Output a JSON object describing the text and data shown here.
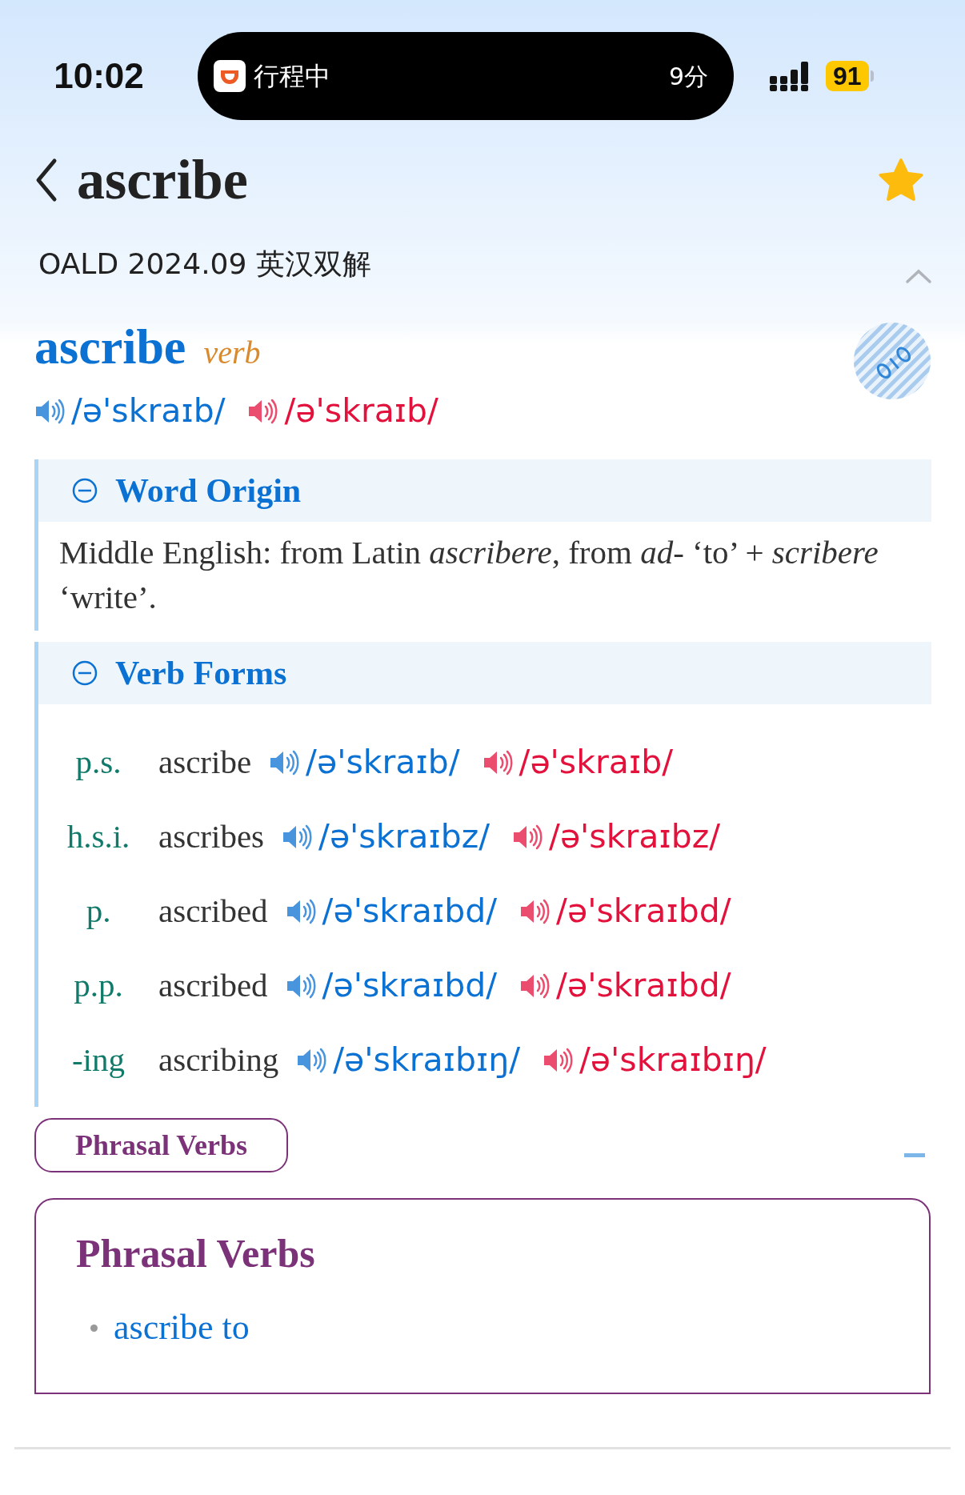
{
  "status_bar": {
    "time": "10:02",
    "activity": {
      "label": "行程中",
      "duration": "9分"
    },
    "battery": "91"
  },
  "header": {
    "title": "ascribe",
    "favorite": true
  },
  "dictionary": {
    "name": "OALD 2024.09 英汉双解",
    "expanded": true
  },
  "entry": {
    "headword": "ascribe",
    "pos": "verb",
    "pronunciations": [
      {
        "text": "/ə'skraɪb/",
        "color": "#0b72d3"
      },
      {
        "text": "/ə'skraɪb/",
        "color": "#e3123c"
      }
    ]
  },
  "sections": [
    {
      "kind": "text",
      "title": "Word Origin",
      "expanded": true,
      "text": "Middle English: from Latin *ascribere*, from *ad-* ‘to’ + *scribere* ‘write’."
    },
    {
      "kind": "forms",
      "title": "Verb Forms",
      "expanded": true,
      "rows": [
        {
          "label": "p.s.",
          "form": "ascribe",
          "pronunciations": [
            {
              "text": "/ə'skraɪb/",
              "color": "#0b72d3"
            },
            {
              "text": "/ə'skraɪb/",
              "color": "#e3123c"
            }
          ]
        },
        {
          "label": "h.s.i.",
          "form": "ascribes",
          "pronunciations": [
            {
              "text": "/ə'skraɪbz/",
              "color": "#0b72d3"
            },
            {
              "text": "/ə'skraɪbz/",
              "color": "#e3123c"
            }
          ]
        },
        {
          "label": "p.",
          "form": "ascribed",
          "pronunciations": [
            {
              "text": "/ə'skraɪbd/",
              "color": "#0b72d3"
            },
            {
              "text": "/ə'skraɪbd/",
              "color": "#e3123c"
            }
          ]
        },
        {
          "label": "p.p.",
          "form": "ascribed",
          "pronunciations": [
            {
              "text": "/ə'skraɪbd/",
              "color": "#0b72d3"
            },
            {
              "text": "/ə'skraɪbd/",
              "color": "#e3123c"
            }
          ]
        },
        {
          "label": "-ing",
          "form": "ascribing",
          "pronunciations": [
            {
              "text": "/ə'skraɪbɪŋ/",
              "color": "#0b72d3"
            },
            {
              "text": "/ə'skraɪbɪŋ/",
              "color": "#e3123c"
            }
          ]
        }
      ]
    }
  ],
  "phrasal_verbs": {
    "tab": "Phrasal Verbs",
    "expanded": true,
    "title": "Phrasal Verbs",
    "items": [
      "ascribe to"
    ]
  }
}
